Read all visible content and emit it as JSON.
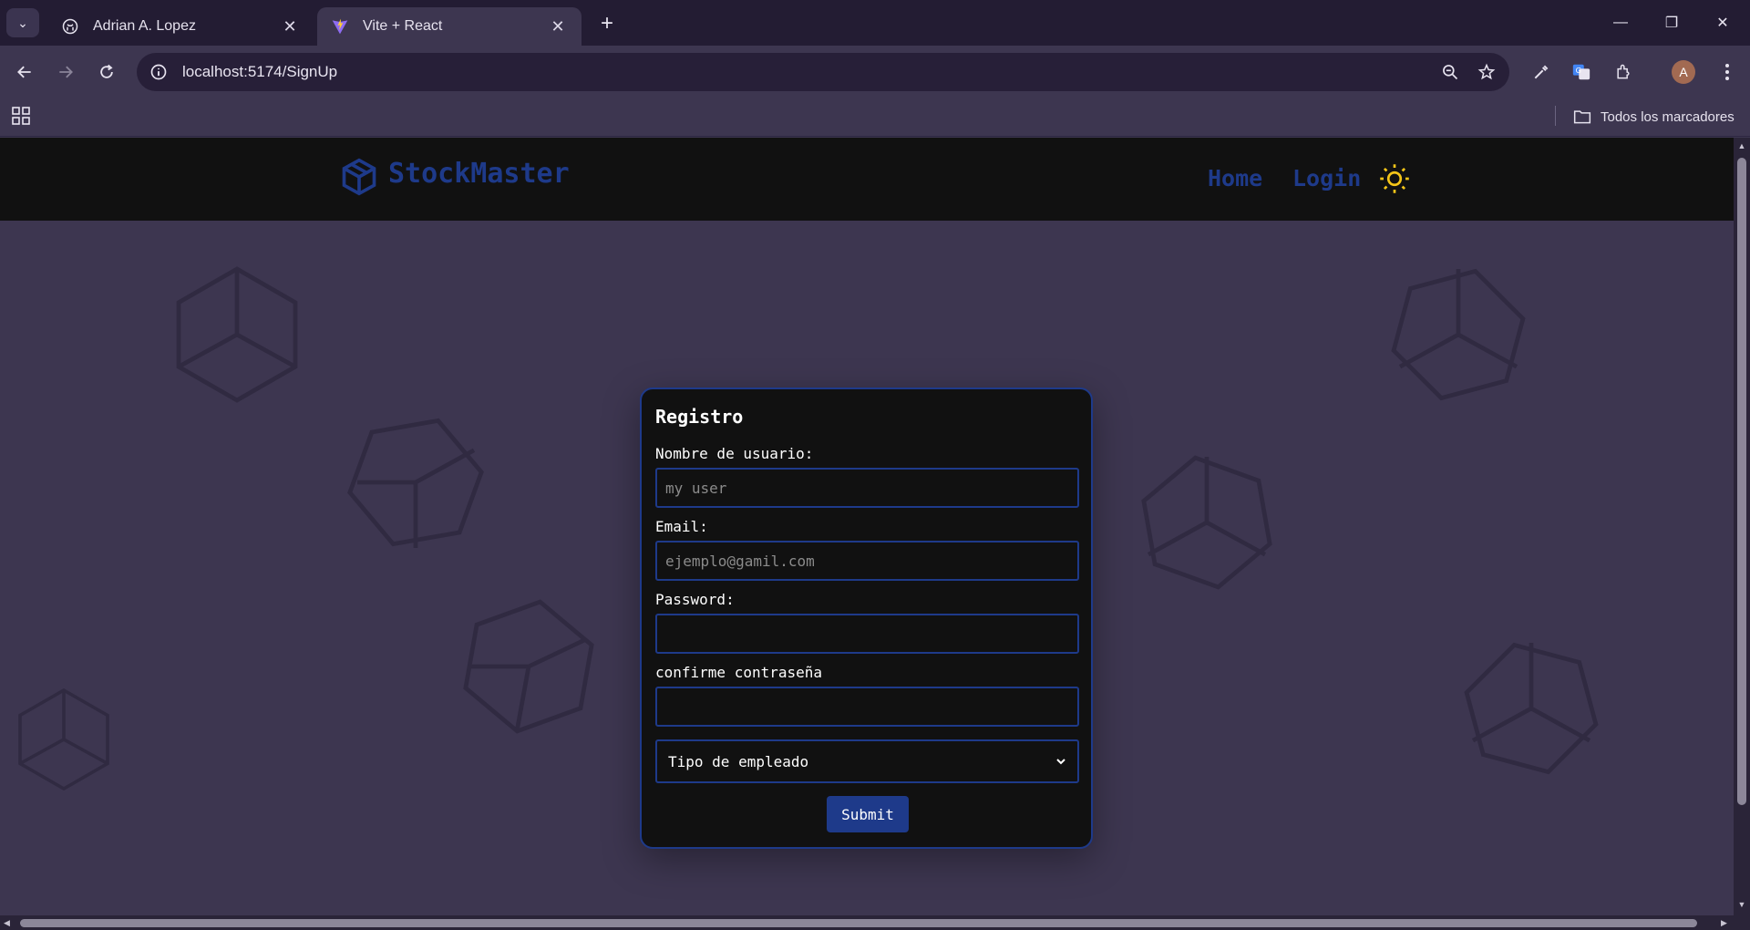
{
  "browser": {
    "tabs": [
      {
        "title": "Adrian A. Lopez",
        "active": false
      },
      {
        "title": "Vite + React",
        "active": true
      }
    ],
    "address": "localhost:5174/SignUp",
    "bookmarks_label": "Todos los marcadores",
    "profile_initial": "A"
  },
  "navbar": {
    "brand": "StockMaster",
    "links": [
      "Home",
      "Login"
    ],
    "accent_color": "#1e3a8a",
    "theme_toggle_color": "#f5c518"
  },
  "form": {
    "title": "Registro",
    "username_label": "Nombre de usuario:",
    "username_placeholder": "my user",
    "email_label": "Email:",
    "email_placeholder": "ejemplo@gamil.com",
    "password_label": "Password:",
    "confirm_label": "confirme contraseña",
    "employee_type": "Tipo de empleado",
    "submit_label": "Submit"
  }
}
